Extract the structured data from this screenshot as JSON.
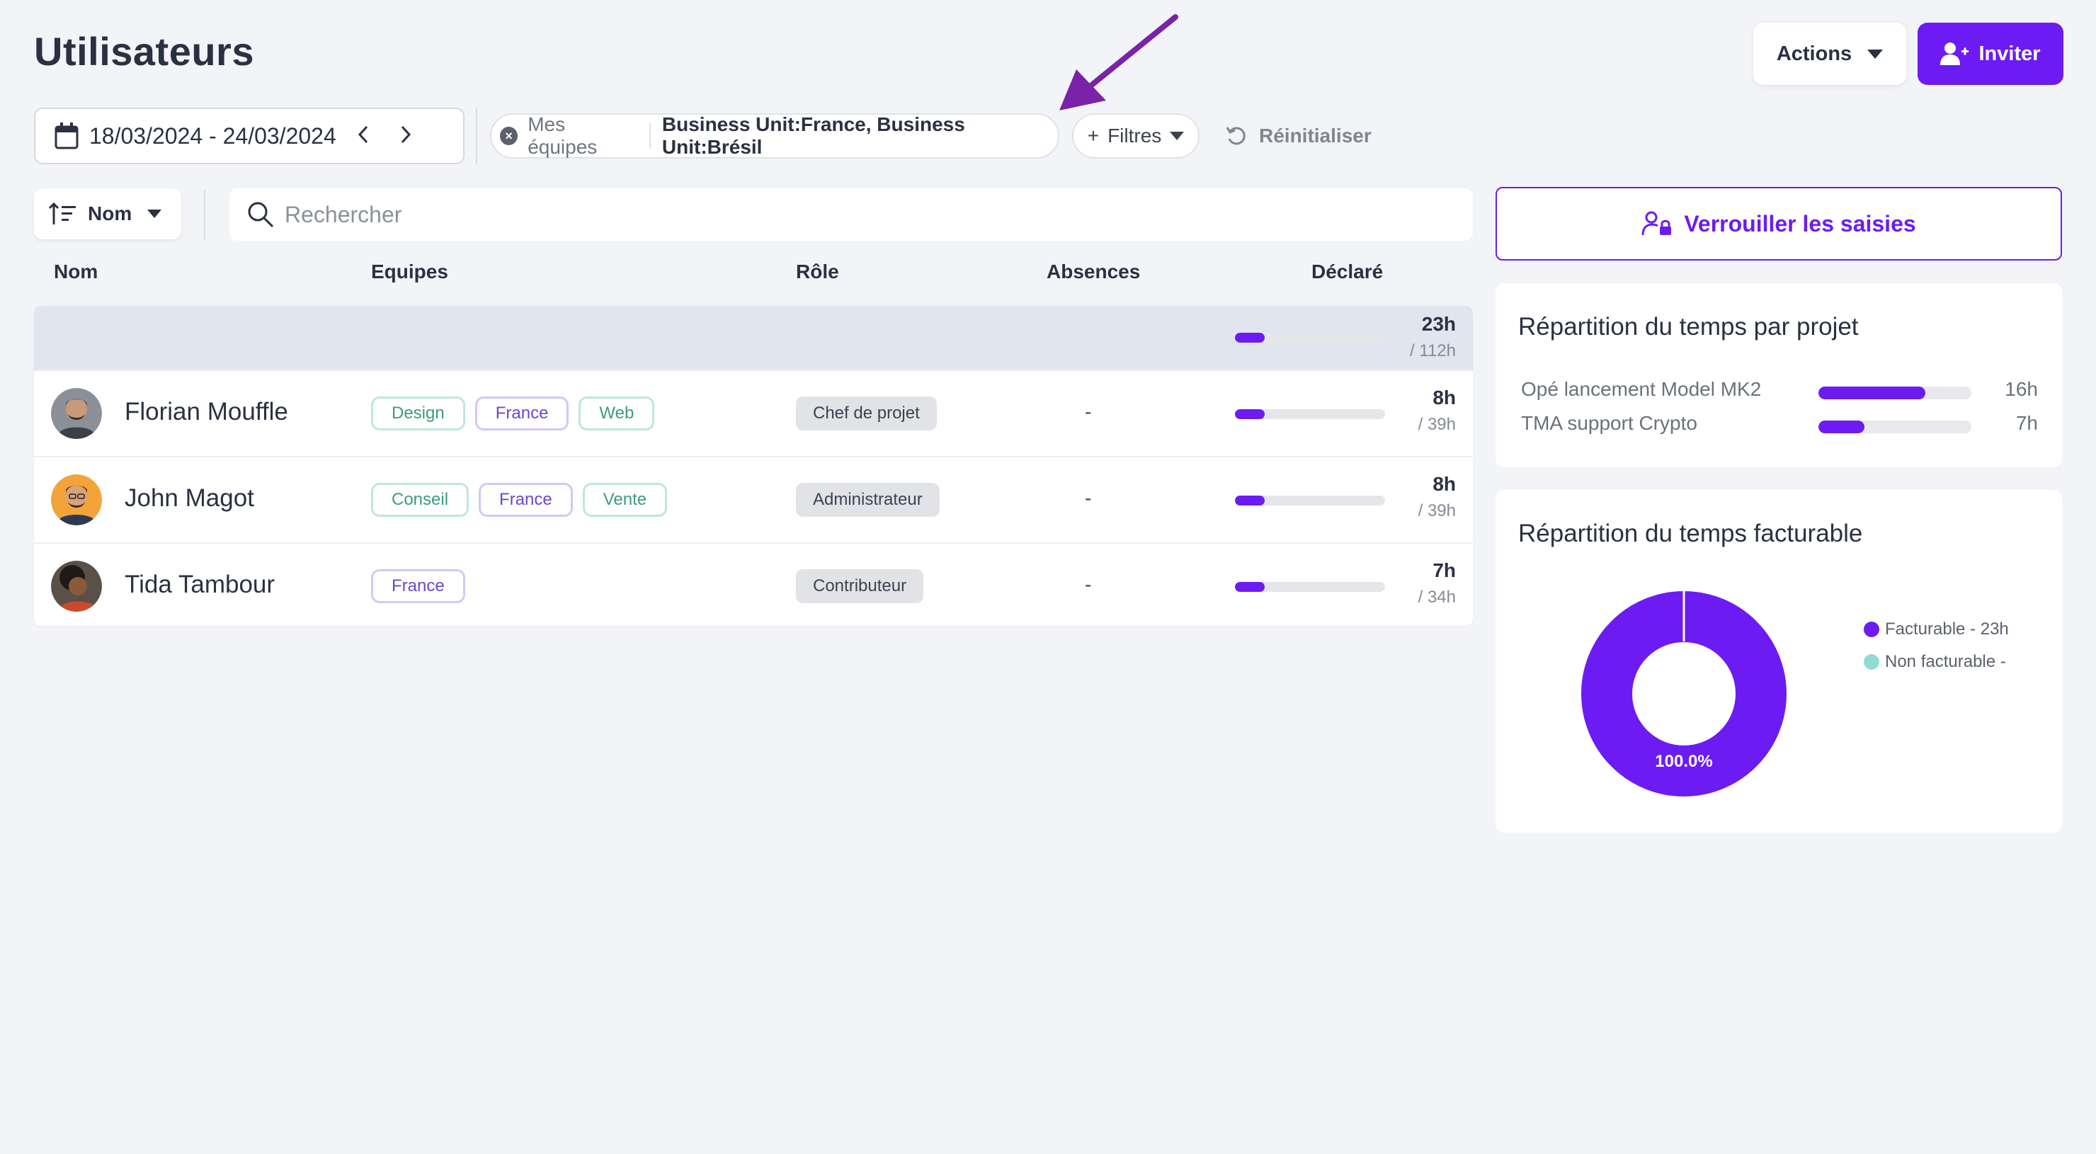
{
  "header": {
    "title": "Utilisateurs",
    "actions_label": "Actions",
    "invite_label": "Inviter"
  },
  "filters": {
    "date_range": "18/03/2024 - 24/03/2024",
    "prev_icon": "chevron-left-icon",
    "next_icon": "chevron-right-icon",
    "teams_chip_key": "Mes équipes",
    "teams_chip_value": "Business Unit:France, Business Unit:Brésil",
    "filters_label": "Filtres",
    "filters_plus": "+",
    "reset_label": "Réinitialiser"
  },
  "toolbar": {
    "sort_label": "Nom",
    "search_placeholder": "Rechercher"
  },
  "table": {
    "columns": [
      "Nom",
      "Equipes",
      "Rôle",
      "Absences",
      "Déclaré"
    ],
    "summary": {
      "declared": "23h",
      "total": "/ 112h",
      "progress": 0.2
    },
    "rows": [
      {
        "name": "Florian Mouffle",
        "tags": [
          "Design",
          "France",
          "Web"
        ],
        "role": "Chef de projet",
        "absences": "-",
        "declared": "8h",
        "total": "/ 39h",
        "progress": 0.2
      },
      {
        "name": "John Magot",
        "tags": [
          "Conseil",
          "France",
          "Vente"
        ],
        "role": "Administrateur",
        "absences": "-",
        "declared": "8h",
        "total": "/ 39h",
        "progress": 0.2
      },
      {
        "name": "Tida Tambour",
        "tags": [
          "France"
        ],
        "role": "Contributeur",
        "absences": "-",
        "declared": "7h",
        "total": "/ 34h",
        "progress": 0.2
      }
    ]
  },
  "side": {
    "lock_label": "Verrouiller les saisies",
    "projects_title": "Répartition du temps par projet",
    "projects": [
      {
        "name": "Opé lancement Model MK2",
        "value": "16h",
        "progress": 0.7
      },
      {
        "name": "TMA support Crypto",
        "value": "7h",
        "progress": 0.3
      }
    ],
    "billable_title": "Répartition du temps facturable",
    "donut_label": "100.0%",
    "legend": [
      {
        "label": "Facturable - 23h",
        "color": "#6c1cf2"
      },
      {
        "label": "Non facturable -",
        "color": "#8fdcd2"
      }
    ]
  },
  "colors": {
    "accent": "#6c1cf2",
    "tag_green": "#3c9a82",
    "tag_purple": "#6a48c9"
  }
}
